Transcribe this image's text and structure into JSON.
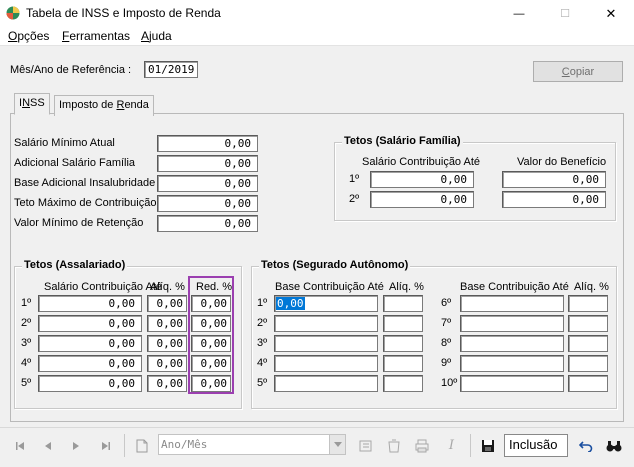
{
  "window": {
    "title": "Tabela de INSS e Imposto de Renda",
    "controls": {
      "minimize": "—",
      "maximize": "☐",
      "close": "✕"
    }
  },
  "menu": [
    "Opções",
    "Ferramentas",
    "Ajuda"
  ],
  "reference": {
    "label": "Mês/Ano de Referência :",
    "value": "01/2019"
  },
  "copy_button": "Copiar",
  "tabs": [
    "INSS",
    "Imposto de Renda"
  ],
  "inss_fields": [
    {
      "label": "Salário Mínimo Atual",
      "value": "0,00"
    },
    {
      "label": "Adicional Salário Família",
      "value": "0,00"
    },
    {
      "label": "Base Adicional Insalubridade",
      "value": "0,00"
    },
    {
      "label": "Teto Máximo de Contribuição",
      "value": "0,00"
    },
    {
      "label": "Valor Mínimo de Retenção",
      "value": "0,00"
    }
  ],
  "salario_familia": {
    "title": "Tetos (Salário Família)",
    "col1": "Salário Contribuição Até",
    "col2": "Valor do Benefício",
    "rows": [
      {
        "n": "1º",
        "a": "0,00",
        "b": "0,00"
      },
      {
        "n": "2º",
        "a": "0,00",
        "b": "0,00"
      }
    ]
  },
  "assalariado": {
    "title": "Tetos (Assalariado)",
    "col1": "Salário Contribuição Até",
    "col2": "Alíq. %",
    "col3": "Red. %",
    "rows": [
      {
        "n": "1º",
        "a": "0,00",
        "b": "0,00",
        "c": "0,00"
      },
      {
        "n": "2º",
        "a": "0,00",
        "b": "0,00",
        "c": "0,00"
      },
      {
        "n": "3º",
        "a": "0,00",
        "b": "0,00",
        "c": "0,00"
      },
      {
        "n": "4º",
        "a": "0,00",
        "b": "0,00",
        "c": "0,00"
      },
      {
        "n": "5º",
        "a": "0,00",
        "b": "0,00",
        "c": "0,00"
      }
    ]
  },
  "autonomo": {
    "title": "Tetos (Segurado Autônomo)",
    "col1": "Base Contribuição Até",
    "col2": "Alíq. %",
    "left": [
      {
        "n": "1º",
        "a": "0,00"
      },
      {
        "n": "2º",
        "a": ""
      },
      {
        "n": "3º",
        "a": ""
      },
      {
        "n": "4º",
        "a": ""
      },
      {
        "n": "5º",
        "a": ""
      }
    ],
    "right": [
      {
        "n": "6º"
      },
      {
        "n": "7º"
      },
      {
        "n": "8º"
      },
      {
        "n": "9º"
      },
      {
        "n": "10º"
      }
    ]
  },
  "navbar": {
    "combo_placeholder": "Ano/Mês",
    "status": "Inclusão",
    "icons": [
      "first-record-icon",
      "prev-record-icon",
      "next-record-icon",
      "last-record-icon",
      "new-record-icon",
      "stamp-icon",
      "delete-icon",
      "print-icon",
      "italic-icon",
      "save-icon",
      "undo-icon",
      "find-icon"
    ]
  },
  "colors": {
    "highlight": "#9b3fb0",
    "selection": "#0078d7"
  }
}
